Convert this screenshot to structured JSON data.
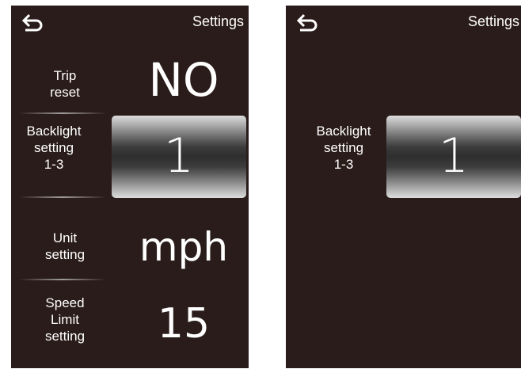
{
  "left_screen": {
    "title": "Settings",
    "back_icon": "back-arrow-icon",
    "rows": [
      {
        "label": "Trip\nreset",
        "value": "NO"
      },
      {
        "label": "Backlight\nsetting\n1-3",
        "value": "1"
      },
      {
        "label": "Unit\nsetting",
        "value": "mph"
      },
      {
        "label": "Speed\nLimit\nsetting",
        "value": "15"
      }
    ]
  },
  "right_screen": {
    "title": "Settings",
    "back_icon": "back-arrow-icon",
    "row": {
      "label": "Backlight\nsetting\n1-3",
      "value": "1"
    }
  },
  "colors": {
    "screen_background": "#2a1c1a",
    "text": "#ffffff"
  }
}
